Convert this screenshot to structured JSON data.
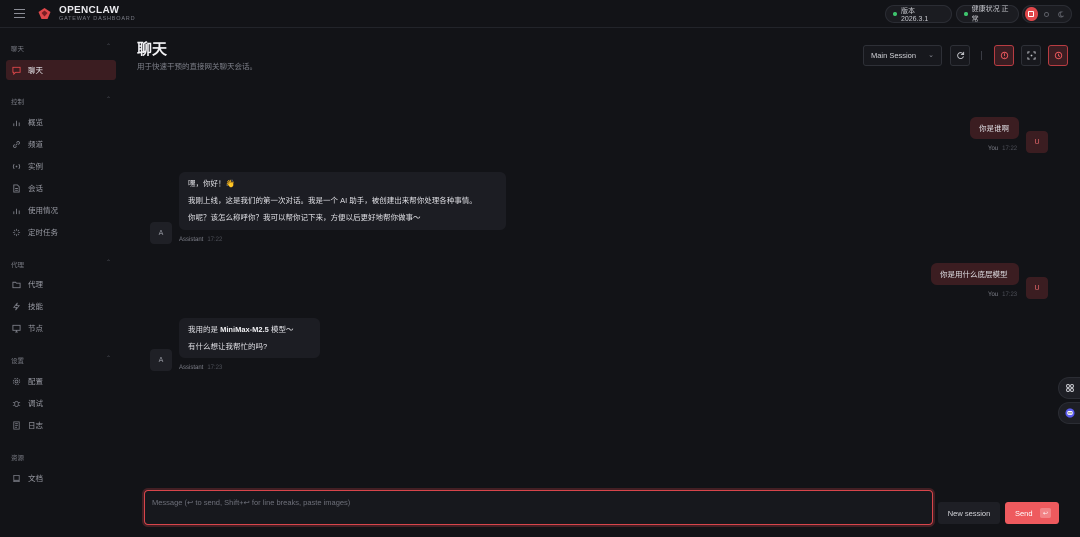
{
  "app": {
    "brand_title": "OPENCLAW",
    "brand_subtitle": "GATEWAY DASHBOARD",
    "version_label": "版本 2026.3.1",
    "health_label": "健康状况 正常"
  },
  "sidebar": {
    "sections": [
      {
        "title": "聊天",
        "items": [
          {
            "label": "聊天",
            "icon": "chat-icon",
            "active": true
          }
        ]
      },
      {
        "title": "控制",
        "items": [
          {
            "label": "概览",
            "icon": "bar-chart-icon"
          },
          {
            "label": "频道",
            "icon": "link-icon"
          },
          {
            "label": "实例",
            "icon": "broadcast-icon"
          },
          {
            "label": "会话",
            "icon": "file-icon"
          },
          {
            "label": "使用情况",
            "icon": "bar-chart-icon"
          },
          {
            "label": "定时任务",
            "icon": "spinner-icon"
          }
        ]
      },
      {
        "title": "代理",
        "items": [
          {
            "label": "代理",
            "icon": "folder-icon"
          },
          {
            "label": "技能",
            "icon": "bolt-icon"
          },
          {
            "label": "节点",
            "icon": "monitor-icon"
          }
        ]
      },
      {
        "title": "设置",
        "items": [
          {
            "label": "配置",
            "icon": "gear-icon"
          },
          {
            "label": "调试",
            "icon": "bug-icon"
          },
          {
            "label": "日志",
            "icon": "log-icon"
          }
        ]
      },
      {
        "title": "资源",
        "items": [
          {
            "label": "文档",
            "icon": "book-icon"
          }
        ]
      }
    ]
  },
  "header": {
    "title": "聊天",
    "subtitle": "用于快速干预的直接网关聊天会话。",
    "session_select": "Main Session"
  },
  "messages": [
    {
      "role": "user",
      "avatar": "U",
      "lines": [
        "你是谁啊"
      ],
      "sender": "You",
      "time": "17:22"
    },
    {
      "role": "assistant",
      "avatar": "A",
      "lines": [
        "嘿，你好！👋",
        "我刚上线，这是我们的第一次对话。我是一个 AI 助手，被创建出来帮你处理各种事情。",
        "你呢？该怎么称呼你？我可以帮你记下来，方便以后更好地帮你做事～"
      ],
      "sender": "Assistant",
      "time": "17:22"
    },
    {
      "role": "user",
      "avatar": "U",
      "lines": [
        "你是用什么底层模型"
      ],
      "sender": "You",
      "time": "17:23"
    },
    {
      "role": "assistant",
      "avatar": "A",
      "line1_prefix": "我用的是 ",
      "line1_bold": "MiniMax-M2.5",
      "line1_suffix": " 模型～",
      "lines": [
        "有什么想让我帮忙的吗?"
      ],
      "sender": "Assistant",
      "time": "17:23"
    }
  ],
  "composer": {
    "placeholder": "Message (↩ to send, Shift+↩ for line breaks, paste images)",
    "new_session_label": "New session",
    "send_label": "Send",
    "send_kbd": "↩"
  },
  "colors": {
    "accent": "#ee5a5e",
    "background": "#121317",
    "status_ok": "#3ec46d"
  }
}
